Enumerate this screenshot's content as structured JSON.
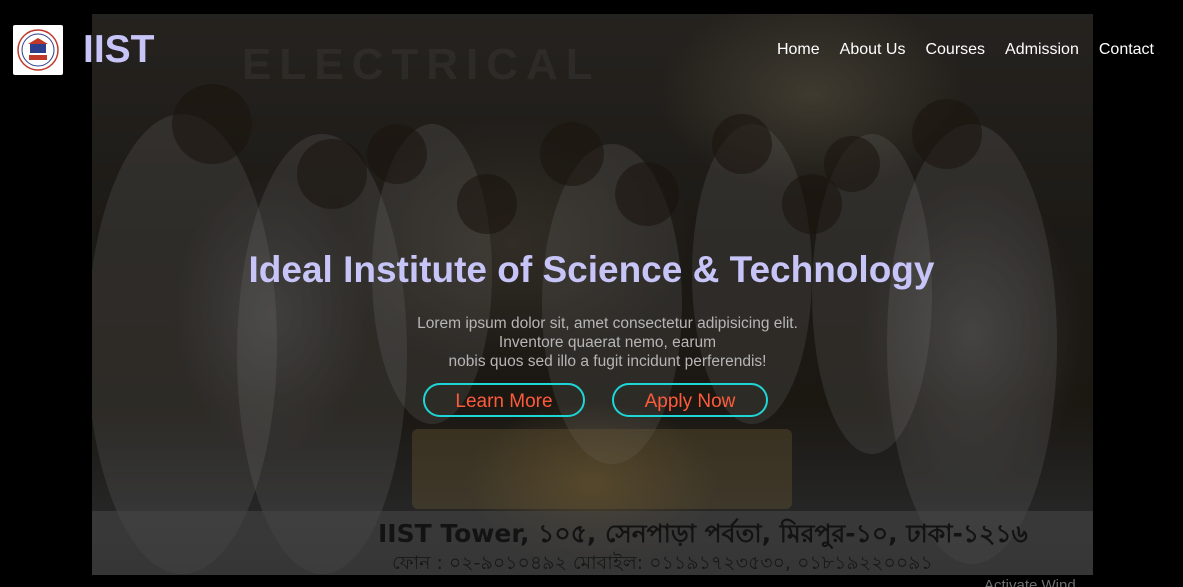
{
  "header": {
    "brand": "IIST",
    "logo_icon": "institute-crest-icon",
    "nav": [
      {
        "label": "Home"
      },
      {
        "label": "About Us"
      },
      {
        "label": "Courses"
      },
      {
        "label": "Admission"
      },
      {
        "label": "Contact"
      }
    ]
  },
  "hero": {
    "title": "Ideal Institute of Science & Technology",
    "description_lines": [
      "Lorem ipsum dolor sit, amet consectetur adipisicing elit.",
      "Inventore quaerat nemo, earum",
      "nobis quos sed illo a fugit incidunt perferendis!"
    ],
    "learn_more_label": "Learn More",
    "apply_now_label": "Apply Now",
    "photo_sign_text": "ELECTRICAL",
    "photo_caption_line1": "IIST Tower, ১০৫, সেনপাড়া পর্বতা, মিরপুর-১০, ঢাকা-১২১৬",
    "photo_caption_line2": "ফোন : ০২-৯০১০৪৯২ মোবাইল: ০১১৯১৭২৩৫৩০, ০১৮১৯২২০০৯১"
  },
  "watermark": "Activate Wind",
  "colors": {
    "brand": "#c7c4f8",
    "button_border": "#1fd6d6",
    "button_text": "#ff5a3c",
    "background": "#000000"
  }
}
